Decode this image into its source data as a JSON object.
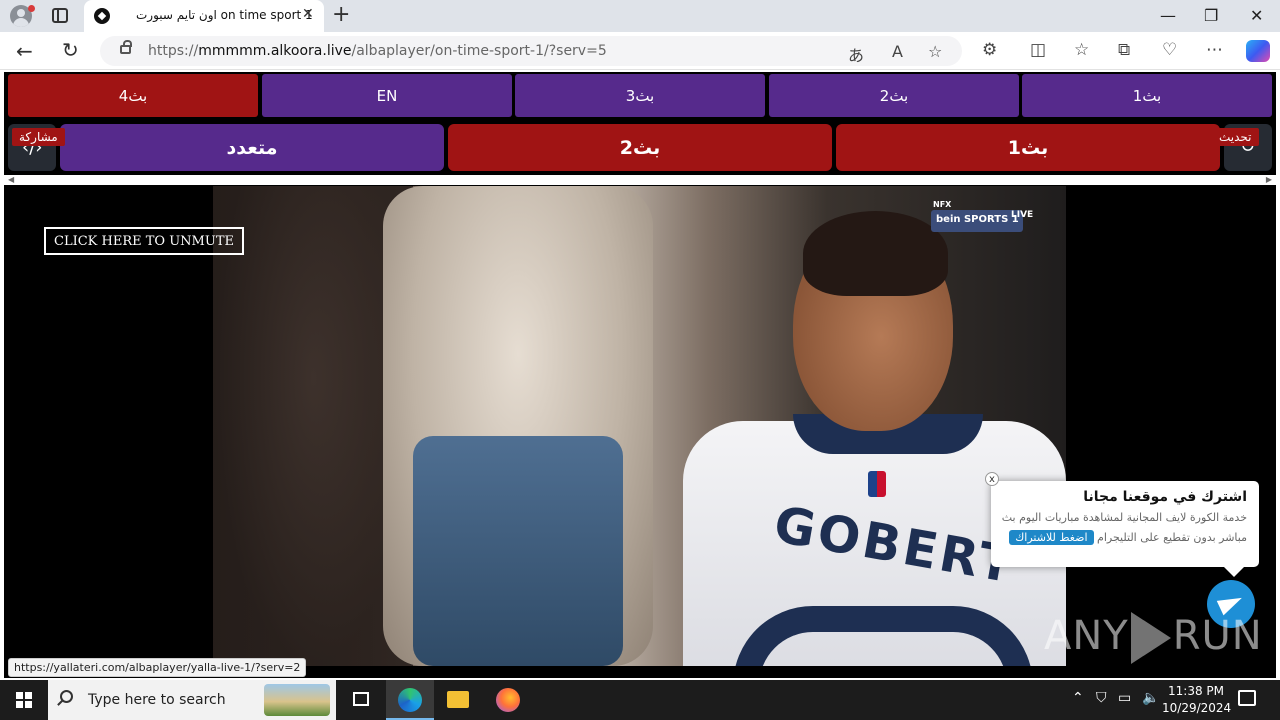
{
  "browser": {
    "tab_title": "اون تايم سبورت on time sport 1",
    "tab_close": "✕",
    "new_tab": "+",
    "url_prefix": "https://",
    "url_host": "mmmmm.alkoora.live",
    "url_path": "/albaplayer/on-time-sport-1/?serv=5",
    "window_controls": {
      "minimize": "—",
      "maximize": "❐",
      "close": "✕"
    },
    "icons": [
      "back-icon",
      "reload-icon",
      "lock-icon",
      "read-aloud-icon",
      "favorite-icon",
      "extensions-icon",
      "split-screen-icon",
      "favorites-icon",
      "collections-icon",
      "browser-essentials-icon",
      "more-icon",
      "copilot-icon"
    ]
  },
  "servers_top": [
    {
      "label": "بث4",
      "color": "#a01414"
    },
    {
      "label": "EN",
      "color": "#562a8c"
    },
    {
      "label": "بث3",
      "color": "#562a8c"
    },
    {
      "label": "بث2",
      "color": "#562a8c"
    },
    {
      "label": "بث1",
      "color": "#562a8c"
    }
  ],
  "servers_bottom": [
    {
      "label": "متعدد",
      "color": "#562a8c"
    },
    {
      "label": "بث2",
      "color": "#a01414"
    },
    {
      "label": "بث1",
      "color": "#a01414"
    }
  ],
  "side": {
    "share_label": "مشاركة",
    "share_glyph": "‹/›",
    "refresh_label": "تحديث",
    "refresh_glyph": "↻"
  },
  "video": {
    "unmute_label": "CLICK HERE TO UNMUTE",
    "jersey_name": "GOBERT",
    "channel_logo": "bein SPORTS 1",
    "live": "LIVE",
    "nfx": "NFX"
  },
  "status_url": "https://yallateri.com/albaplayer/yalla-live-1/?serv=2",
  "popup": {
    "title": "اشترك في موقعنا مجانا",
    "line1": "خدمة الكورة لايف المجانية لمشاهدة مباريات اليوم بث",
    "line2": "مباشر بدون تقطيع على التليجرام",
    "subscribe": "اضغط للاشتراك",
    "close": "x"
  },
  "watermark": {
    "left": "ANY",
    "right": "RUN"
  },
  "taskbar": {
    "search_placeholder": "Type here to search",
    "time": "11:38 PM",
    "date": "10/29/2024"
  },
  "colors": {
    "red": "#a01414",
    "purple": "#562a8c",
    "telegram": "#1e8fd6"
  }
}
